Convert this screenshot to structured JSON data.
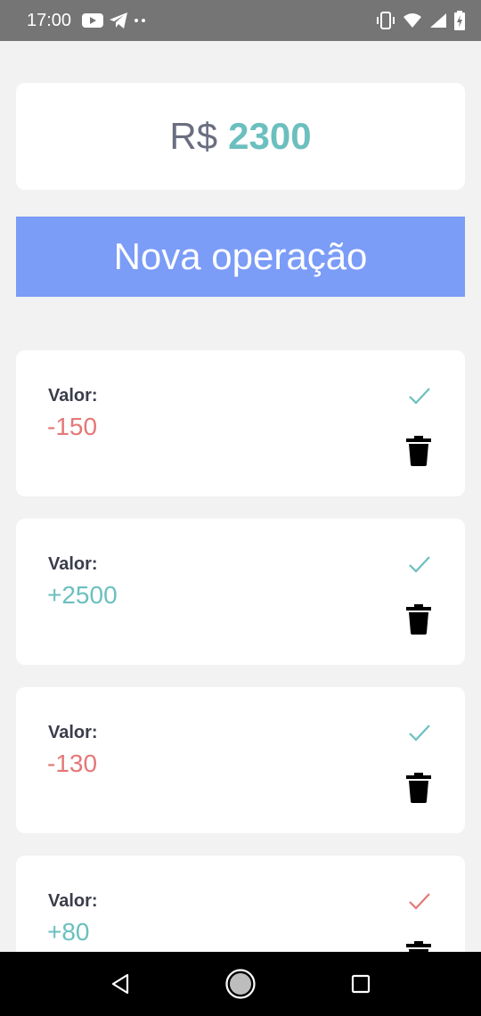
{
  "status_bar": {
    "time": "17:00",
    "left_icons": [
      "youtube-icon",
      "telegram-icon",
      "more-dots-icon"
    ],
    "right_icons": [
      "vibrate-icon",
      "wifi-icon",
      "signal-icon",
      "battery-icon"
    ]
  },
  "balance": {
    "currency": "R$",
    "amount": "2300"
  },
  "new_operation": {
    "label": "Nova operação"
  },
  "operations": [
    {
      "label": "Valor:",
      "value": "-150",
      "sign": "negative",
      "status": "confirmed",
      "check_color": "#6cbfbf"
    },
    {
      "label": "Valor:",
      "value": "+2500",
      "sign": "positive",
      "status": "confirmed",
      "check_color": "#6cbfbf"
    },
    {
      "label": "Valor:",
      "value": "-130",
      "sign": "negative",
      "status": "confirmed",
      "check_color": "#6cbfbf"
    },
    {
      "label": "Valor:",
      "value": "+80",
      "sign": "positive",
      "status": "confirmed",
      "check_color": "#e47878"
    }
  ],
  "nav_bar": {
    "buttons": [
      "back-icon",
      "home-icon",
      "recents-icon"
    ]
  },
  "colors": {
    "positive": "#6cbfbf",
    "negative": "#e47878",
    "button": "#7b9cf7",
    "background": "#f2f2f2"
  }
}
